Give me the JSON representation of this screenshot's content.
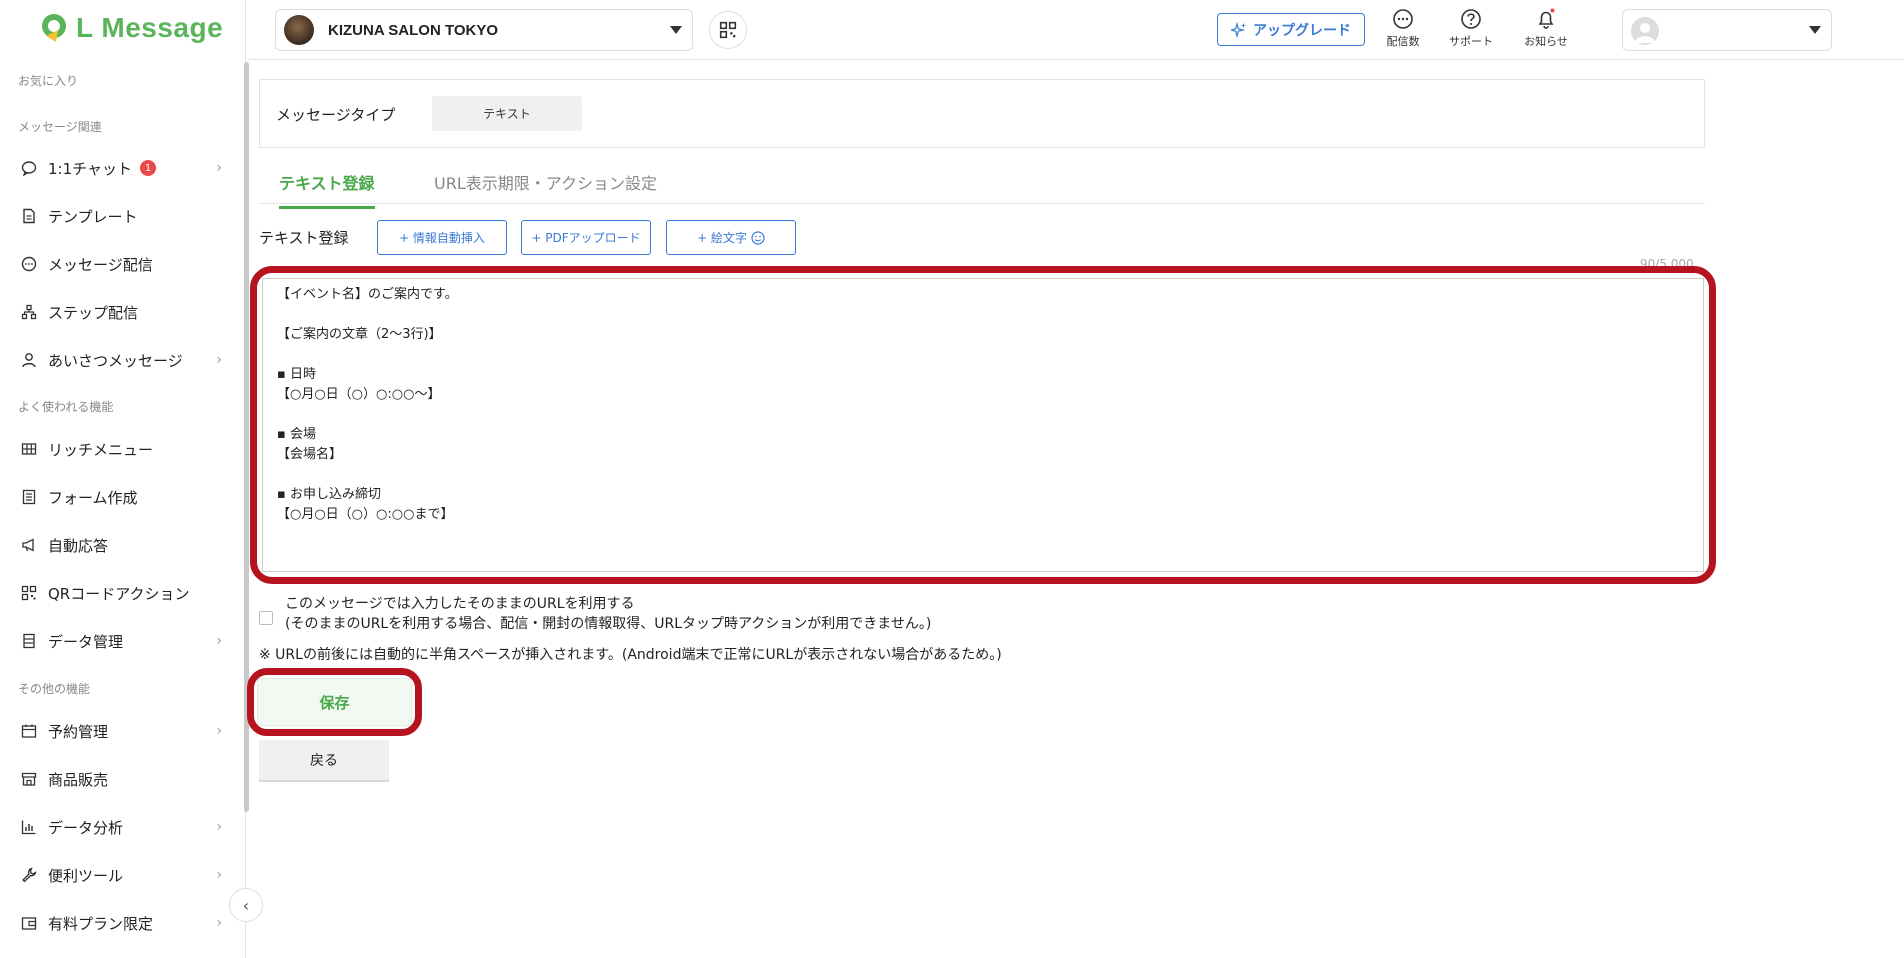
{
  "app": {
    "logo_text": "L Message"
  },
  "header": {
    "account_name": "KIZUNA SALON TOKYO",
    "upgrade_label": "アップグレード",
    "icons": [
      {
        "name": "message-count-icon",
        "label": "配信数"
      },
      {
        "name": "support-icon",
        "label": "サポート"
      },
      {
        "name": "notification-icon",
        "label": "お知らせ"
      }
    ]
  },
  "sidebar": {
    "sections": {
      "favorites": "お気に入り",
      "message_related": "メッセージ関連",
      "common_features": "よく使われる機能",
      "other_features": "その他の機能"
    },
    "items": [
      {
        "label": "1:1チャット",
        "badge": "1",
        "chevron": true,
        "icon": "chat-icon"
      },
      {
        "label": "テンプレート",
        "icon": "template-icon"
      },
      {
        "label": "メッセージ配信",
        "icon": "message-icon"
      },
      {
        "label": "ステップ配信",
        "icon": "step-icon"
      },
      {
        "label": "あいさつメッセージ",
        "chevron": true,
        "icon": "user-icon"
      },
      {
        "label": "リッチメニュー",
        "icon": "grid-icon"
      },
      {
        "label": "フォーム作成",
        "icon": "form-icon"
      },
      {
        "label": "自動応答",
        "icon": "megaphone-icon"
      },
      {
        "label": "QRコードアクション",
        "icon": "qr-icon"
      },
      {
        "label": "データ管理",
        "chevron": true,
        "icon": "data-icon"
      },
      {
        "label": "予約管理",
        "chevron": true,
        "icon": "calendar-icon"
      },
      {
        "label": "商品販売",
        "icon": "shop-icon"
      },
      {
        "label": "データ分析",
        "chevron": true,
        "icon": "chart-icon"
      },
      {
        "label": "便利ツール",
        "chevron": true,
        "icon": "wrench-icon"
      },
      {
        "label": "有料プラン限定",
        "chevron": true,
        "icon": "wallet-icon"
      }
    ]
  },
  "main": {
    "message_type_label": "メッセージタイプ",
    "message_type_value": "テキスト",
    "tabs": [
      {
        "label": "テキスト登録",
        "active": true
      },
      {
        "label": "URL表示期限・アクション設定",
        "active": false
      }
    ],
    "text_reg_label": "テキスト登録",
    "buttons": {
      "insert_info": "+ 情報自動挿入",
      "pdf_upload": "+ PDFアップロード",
      "emoji": "+ 絵文字"
    },
    "counter": "90/5,000",
    "textarea_value": "【イベント名】のご案内です。\n\n【ご案内の文章（2〜3行)】\n\n▪ 日時\n【○月○日（○）○:○○〜】\n\n▪ 会場\n【会場名】\n\n▪ お申し込み締切\n【○月○日（○）○:○○まで】",
    "checkbox_line1": "このメッセージでは入力したそのままのURLを利用する",
    "checkbox_line2": "(そのままのURLを利用する場合、配信・開封の情報取得、URLタップ時アクションが利用できません。)",
    "note": "※ URLの前後には自動的に半角スペースが挿入されます。(Android端末で正常にURLが表示されない場合があるため。)",
    "save_label": "保存",
    "back_label": "戻る"
  },
  "colors": {
    "brand_green": "#4aa84a",
    "link_blue": "#3a7bd5",
    "highlight_red": "#b5141f",
    "badge_red": "#e84a4a"
  }
}
